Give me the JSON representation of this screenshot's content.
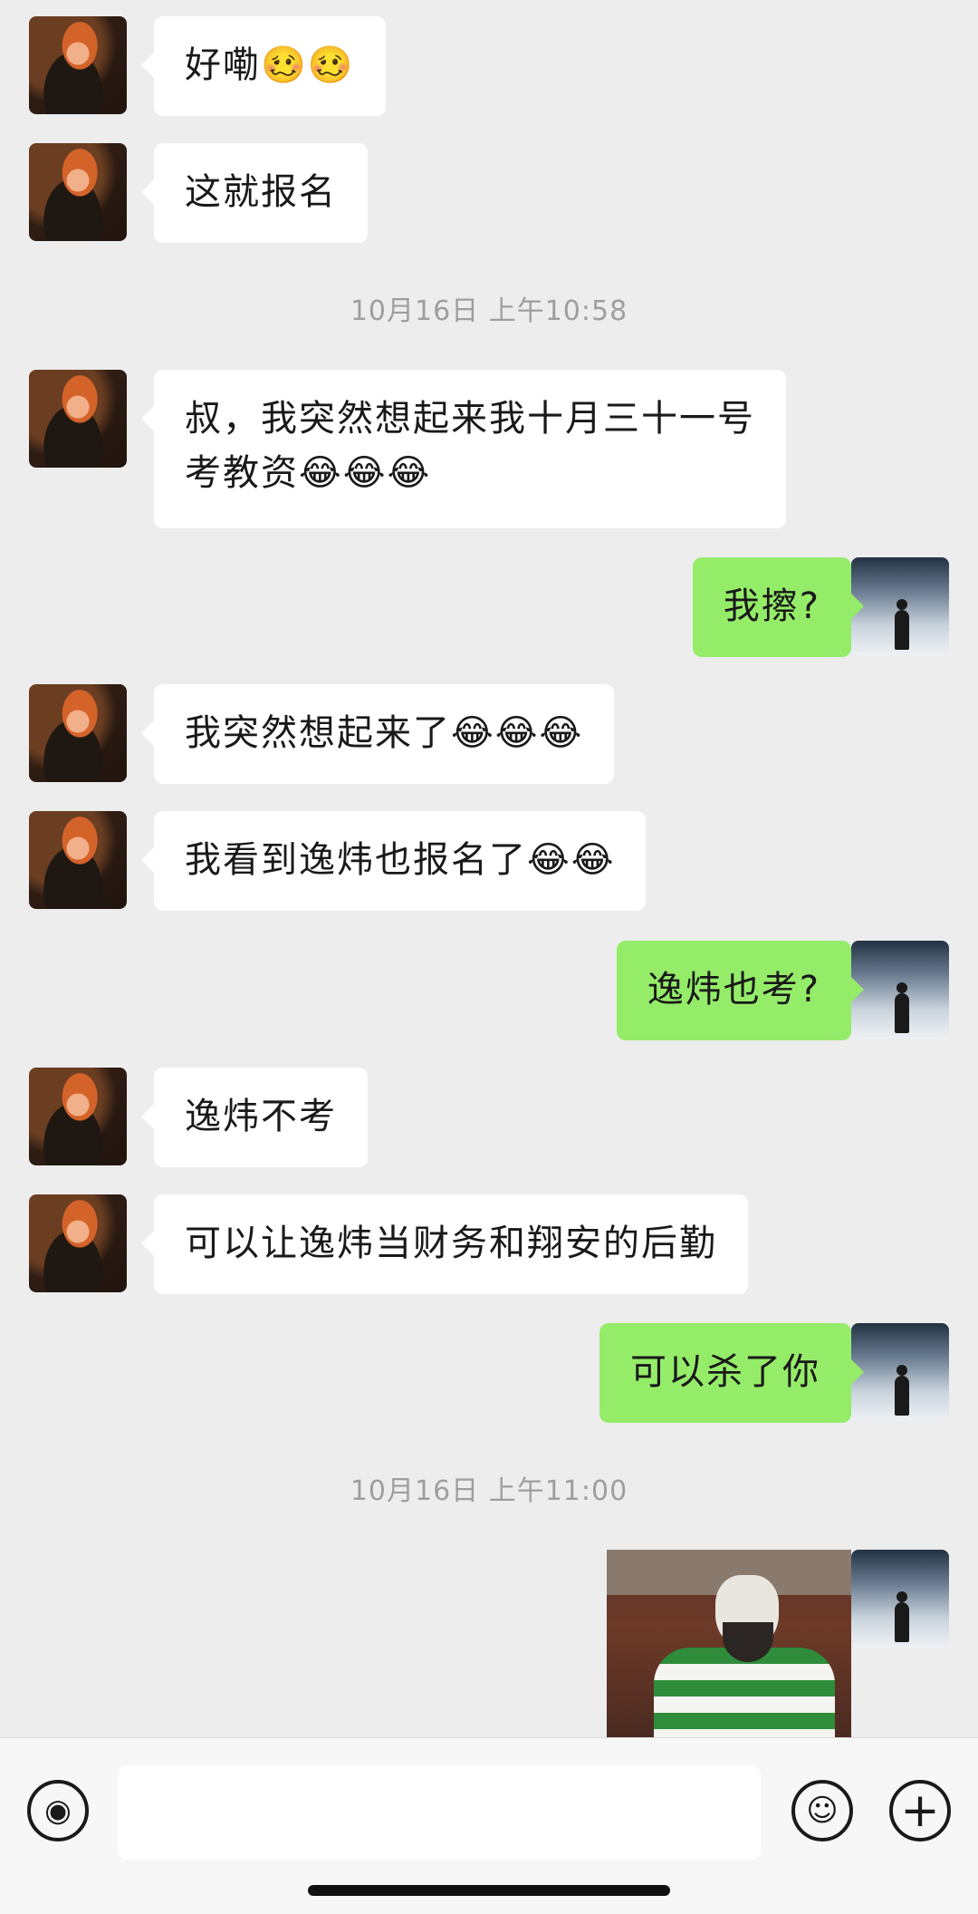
{
  "messages": [
    {
      "side": "left",
      "text": "好嘞",
      "emoji": "🥴🥴"
    },
    {
      "side": "left",
      "text": "这就报名",
      "emoji": ""
    },
    {
      "timestamp": "10月16日 上午10:58"
    },
    {
      "side": "left",
      "text": "叔，我突然想起来我十月三十一号",
      "text2": "考教资",
      "emoji": "😂😂😂"
    },
    {
      "side": "right",
      "text": "我擦?",
      "emoji": ""
    },
    {
      "side": "left",
      "text": "我突然想起来了",
      "emoji": "😂😂😂"
    },
    {
      "side": "left",
      "text": "我看到逸炜也报名了",
      "emoji": "😂😂"
    },
    {
      "side": "right",
      "text": "逸炜也考?",
      "emoji": ""
    },
    {
      "side": "left",
      "text": "逸炜不考",
      "emoji": ""
    },
    {
      "side": "left",
      "text": "可以让逸炜当财务和翔安的后勤",
      "emoji": ""
    },
    {
      "side": "right",
      "text": "可以杀了你",
      "emoji": ""
    },
    {
      "timestamp": "10月16日 上午11:00"
    }
  ],
  "icons": {
    "voice": "voice-icon",
    "emoji": "emoji-icon",
    "plus": "plus-icon"
  },
  "glyphs": {
    "voice": "◉",
    "emoji": "☺",
    "plus": "+"
  },
  "colors": {
    "background": "#ededed",
    "self_bubble": "#95ec69",
    "other_bubble": "#ffffff",
    "timestamp": "#9e9e9e"
  }
}
